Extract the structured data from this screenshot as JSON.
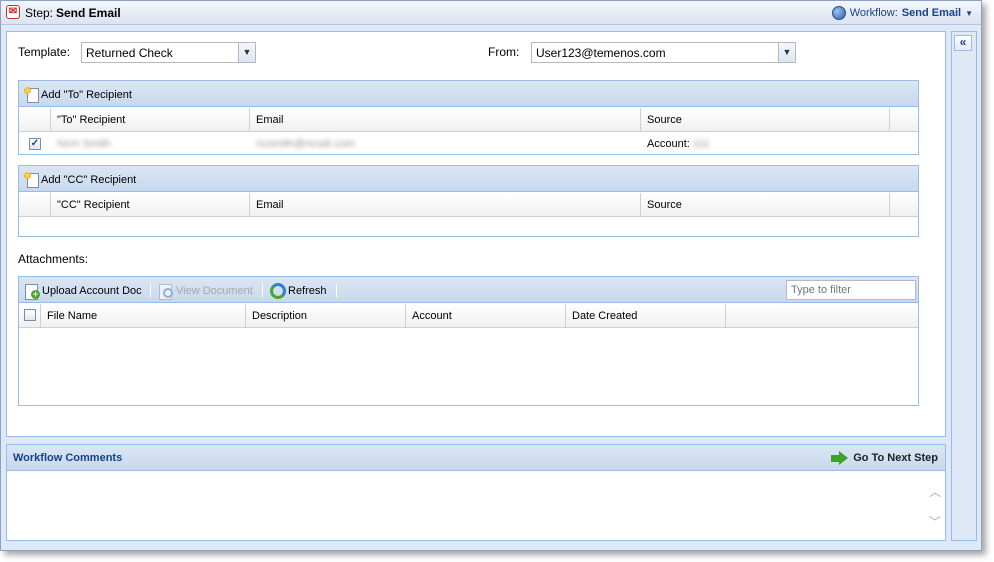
{
  "titlebar": {
    "step_prefix": "Step:",
    "step_name": "Send Email",
    "workflow_prefix": "Workflow:",
    "workflow_name": "Send Email"
  },
  "form": {
    "template_label": "Template:",
    "template_value": "Returned Check",
    "from_label": "From:",
    "from_value": "User123@temenos.com"
  },
  "to_grid": {
    "add_label": "Add \"To\" Recipient",
    "columns": [
      "\"To\" Recipient",
      "Email",
      "Source"
    ],
    "rows": [
      {
        "checked": true,
        "recipient": "Ncm Smith",
        "email": "ncsmith@ncsdr.com",
        "source_prefix": "Account:",
        "source_value": "111"
      }
    ]
  },
  "cc_grid": {
    "add_label": "Add \"CC\" Recipient",
    "columns": [
      "\"CC\" Recipient",
      "Email",
      "Source"
    ]
  },
  "attachments": {
    "label": "Attachments:",
    "upload_label": "Upload Account Doc",
    "view_label": "View Document",
    "refresh_label": "Refresh",
    "filter_placeholder": "Type to filter",
    "columns": [
      "File Name",
      "Description",
      "Account",
      "Date Created"
    ]
  },
  "comments": {
    "title": "Workflow Comments",
    "next_step_label": "Go To Next Step"
  },
  "colors": {
    "panel_border": "#99bbe8",
    "header_blue": "#15428b",
    "toolbar_bg": "#dae6f4"
  }
}
